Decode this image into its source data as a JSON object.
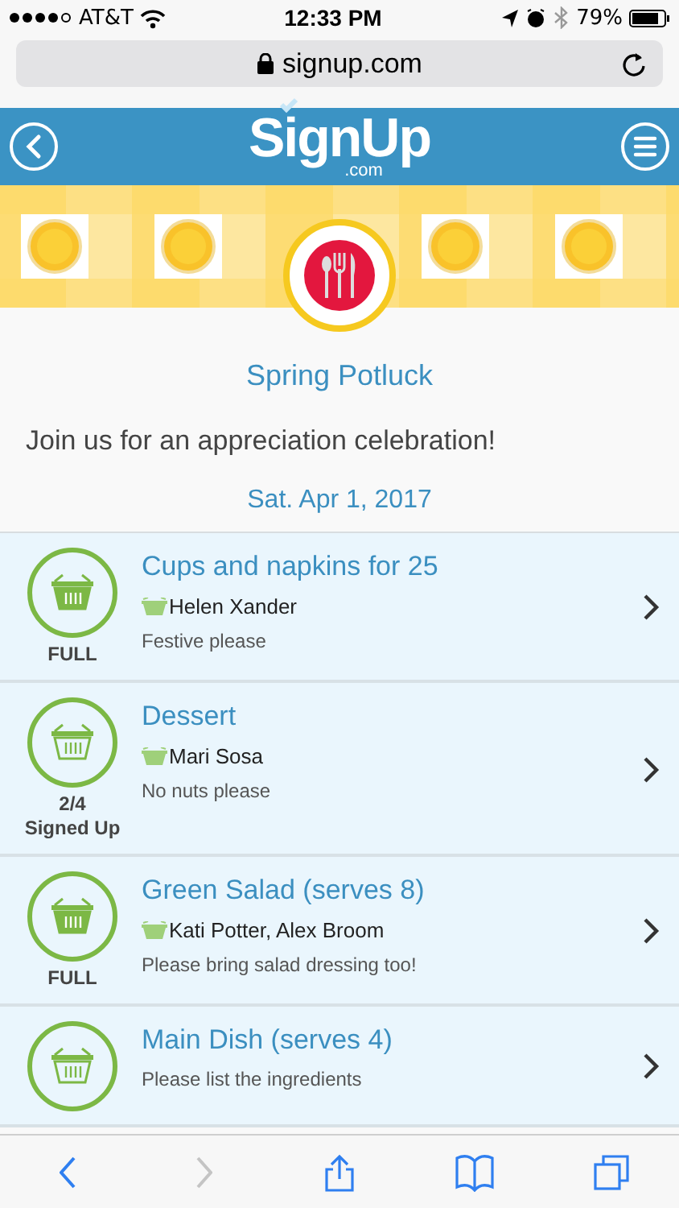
{
  "status_bar": {
    "carrier": "AT&T",
    "time": "12:33 PM",
    "battery": "79%"
  },
  "browser": {
    "url": "signup.com"
  },
  "header": {
    "logo": "SignUp",
    "logo_suffix": ".com"
  },
  "event": {
    "title": "Spring Potluck",
    "description": "Join us for an appreciation celebration!",
    "date": "Sat. Apr 1, 2017"
  },
  "slots": [
    {
      "title": "Cups and napkins for 25",
      "full": true,
      "status": [
        "FULL"
      ],
      "people": "Helen Xander",
      "note": "Festive please"
    },
    {
      "title": "Dessert",
      "full": false,
      "status": [
        "2/4",
        "Signed Up"
      ],
      "people": "Mari Sosa",
      "note": "No nuts please"
    },
    {
      "title": "Green Salad (serves 8)",
      "full": true,
      "status": [
        "FULL"
      ],
      "people": "Kati Potter, Alex Broom",
      "note": "Please bring salad dressing too!"
    },
    {
      "title": "Main Dish (serves 4)",
      "full": false,
      "note": "Please list the ingredients"
    }
  ],
  "toolbar": [
    {
      "kind": "back",
      "disabled": false
    },
    {
      "kind": "forward",
      "disabled": true
    },
    {
      "kind": "share",
      "disabled": false
    },
    {
      "kind": "bookmarks",
      "disabled": false
    },
    {
      "kind": "tabs",
      "disabled": false
    }
  ]
}
